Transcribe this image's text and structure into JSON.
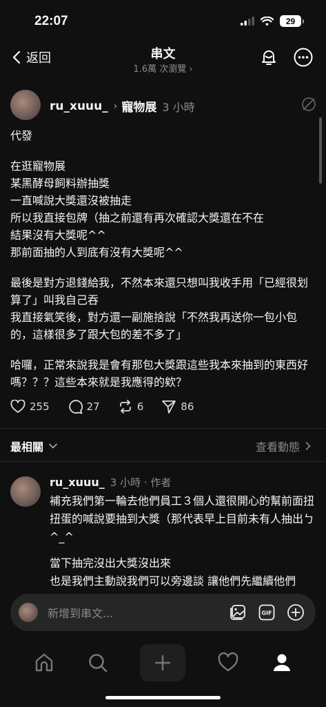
{
  "status_bar": {
    "time": "22:07",
    "battery": "29"
  },
  "header": {
    "back_label": "返回",
    "title": "串文",
    "subtitle": "1.6萬 次瀏覽 ›"
  },
  "post": {
    "username": "ru_xuuu_",
    "topic": "寵物展",
    "time": "3 小時",
    "paragraphs": [
      "代發",
      "在逛寵物展\n某黑酵母飼料辦抽獎\n一直喊說大獎還沒被抽走\n所以我直接包牌（抽之前還有再次確認大獎還在不在\n結果沒有大獎呢^^\n那前面抽的人到底有沒有大獎呢^^",
      "最後是對方退錢給我，不然本來還只想叫我收手用「已經很划算了」叫我自己吞\n我直接氣笑後，對方還一副施捨說「不然我再送你一包小包的，這樣很多了跟大包的差不多了」",
      "哈囉，正常來說我是會有那包大獎跟這些我本來抽到的東西好嗎？？？這些本來就是我應得的欸？"
    ],
    "likes": "255",
    "comments": "27",
    "reposts": "6",
    "shares": "86"
  },
  "replies_header": {
    "sort_label": "最相關",
    "activity_label": "查看動態"
  },
  "reply": {
    "username": "ru_xuuu_",
    "meta": "3 小時 · 作者",
    "paragraphs": [
      "補充我們第一輪去他們員工３個人還很開心的幫前面扭扭蛋的喊說要抽到大獎（那代表早上目前未有人抽出ㄅ^_^",
      "當下抽完沒出大獎沒出來\n也是我們主動說我們可以旁邊談 讓他們先繼續他們"
    ]
  },
  "compose": {
    "placeholder": "新增到串文..."
  },
  "icons": [
    "back-chevron-icon",
    "activity-bell-icon",
    "more-icon",
    "edit-off-icon",
    "heart-icon",
    "comment-icon",
    "repost-icon",
    "share-icon",
    "chevron-down-icon",
    "chevron-right-icon",
    "image-icon",
    "gif-icon",
    "add-circle-icon",
    "home-icon",
    "search-icon",
    "plus-icon",
    "heart-tab-icon",
    "profile-icon"
  ],
  "colors": {
    "background": "#101010",
    "text": "#f3f5f7",
    "muted": "#8a8a8a",
    "compose_bg": "#262626"
  }
}
